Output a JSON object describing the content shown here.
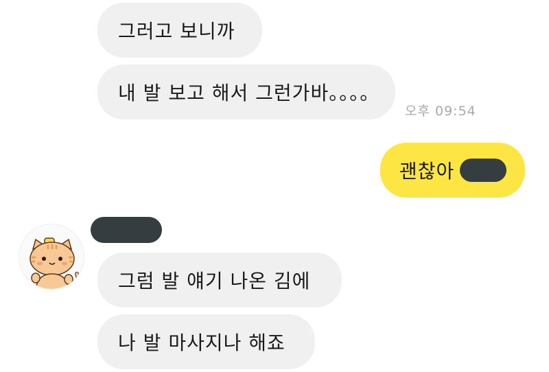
{
  "messages": [
    {
      "text": "그러고 보니까",
      "direction": "incoming"
    },
    {
      "text": "내 발 보고 해서 그런가바。。。。",
      "direction": "incoming"
    },
    {
      "text": "괜찮아",
      "direction": "outgoing"
    },
    {
      "text": "그럼 발 얘기 나온 김에",
      "direction": "incoming"
    },
    {
      "text": "나 발 마사지나 해죠",
      "direction": "incoming"
    }
  ],
  "timestamps": {
    "first_group": "오후 09:54"
  },
  "contact": {
    "avatar_icon": "cat-avatar-icon"
  },
  "colors": {
    "incoming_bubble": "#f0f0f0",
    "outgoing_bubble": "#fde543",
    "redaction": "#363d40",
    "timestamp": "#a9a9a9"
  }
}
